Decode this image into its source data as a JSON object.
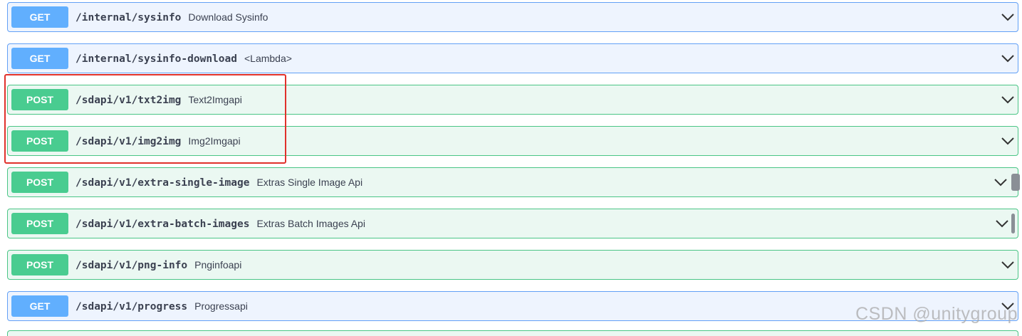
{
  "operations": [
    {
      "method": "GET",
      "path": "/internal/sysinfo",
      "summary": "Download Sysinfo"
    },
    {
      "method": "GET",
      "path": "/internal/sysinfo-download",
      "summary": "<Lambda>"
    },
    {
      "method": "POST",
      "path": "/sdapi/v1/txt2img",
      "summary": "Text2Imgapi"
    },
    {
      "method": "POST",
      "path": "/sdapi/v1/img2img",
      "summary": "Img2Imgapi"
    },
    {
      "method": "POST",
      "path": "/sdapi/v1/extra-single-image",
      "summary": "Extras Single Image Api"
    },
    {
      "method": "POST",
      "path": "/sdapi/v1/extra-batch-images",
      "summary": "Extras Batch Images Api"
    },
    {
      "method": "POST",
      "path": "/sdapi/v1/png-info",
      "summary": "Pnginfoapi"
    },
    {
      "method": "GET",
      "path": "/sdapi/v1/progress",
      "summary": "Progressapi"
    }
  ],
  "watermark": "CSDN @unitygroup",
  "colors": {
    "get_badge": "#61affe",
    "post_badge": "#49cc90",
    "highlight_border": "#e0312b"
  }
}
